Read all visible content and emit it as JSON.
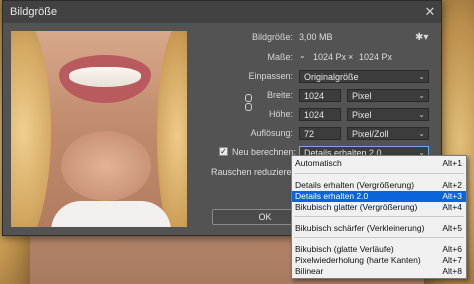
{
  "dialog": {
    "title": "Bildgröße"
  },
  "info": {
    "bildgroesse_label": "Bildgröße:",
    "bildgroesse_value": "3,00 MB",
    "masse_label": "Maße:",
    "masse_width": "1024 Px",
    "masse_x": "×",
    "masse_height": "1024 Px"
  },
  "fields": {
    "einpassen_label": "Einpassen:",
    "einpassen_value": "Originalgröße",
    "breite_label": "Breite:",
    "breite_value": "1024",
    "breite_unit": "Pixel",
    "hoehe_label": "Höhe:",
    "hoehe_value": "1024",
    "hoehe_unit": "Pixel",
    "aufloesung_label": "Auflösung:",
    "aufloesung_value": "72",
    "aufloesung_unit": "Pixel/Zoll",
    "neu_berechnen_label": "Neu berechnen:",
    "neu_berechnen_value": "Details erhalten 2.0",
    "rauschen_label": "Rauschen reduzieren:"
  },
  "buttons": {
    "ok": "OK"
  },
  "menu": {
    "items": [
      {
        "label": "Automatisch",
        "shortcut": "Alt+1"
      },
      {
        "label": "Details erhalten (Vergrößerung)",
        "shortcut": "Alt+2"
      },
      {
        "label": "Details erhalten 2.0",
        "shortcut": "Alt+3"
      },
      {
        "label": "Bikubisch glatter (Vergrößerung)",
        "shortcut": "Alt+4"
      },
      {
        "label": "Bikubisch schärfer (Verkleinerung)",
        "shortcut": "Alt+5"
      },
      {
        "label": "Bikubisch (glatte Verläufe)",
        "shortcut": "Alt+6"
      },
      {
        "label": "Pixelwiederholung (harte Kanten)",
        "shortcut": "Alt+7"
      },
      {
        "label": "Bilinear",
        "shortcut": "Alt+8"
      }
    ],
    "selected": "Details erhalten 2.0"
  },
  "colors": {
    "dialog_bg": "#535353",
    "highlight": "#0b64d9"
  },
  "icons": {
    "close": "close-icon",
    "gear": "gear-icon",
    "chain": "chain-link-icon"
  }
}
